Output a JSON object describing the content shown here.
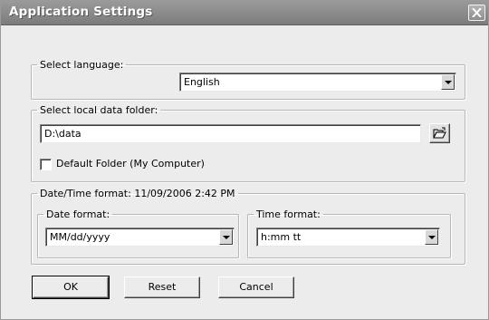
{
  "window": {
    "title": "Application Settings"
  },
  "language": {
    "legend": "Select language:",
    "selected": "English"
  },
  "folder": {
    "legend": "Select local data folder:",
    "path": "D:\\data",
    "default_checkbox_label": "Default Folder (My Computer)",
    "default_checked": false
  },
  "datetime": {
    "legend": "Date/Time format:  11/09/2006 2:42 PM",
    "date_format": {
      "legend": "Date format:",
      "selected": "MM/dd/yyyy"
    },
    "time_format": {
      "legend": "Time format:",
      "selected": "h:mm tt"
    }
  },
  "buttons": {
    "ok": "OK",
    "reset": "Reset",
    "cancel": "Cancel"
  },
  "icons": {
    "close": "close-icon",
    "browse": "folder-open-icon",
    "dropdown": "dropdown-arrow-icon"
  },
  "colors": {
    "titlebar": "#8a8a8a",
    "window_bg": "#ececec"
  }
}
